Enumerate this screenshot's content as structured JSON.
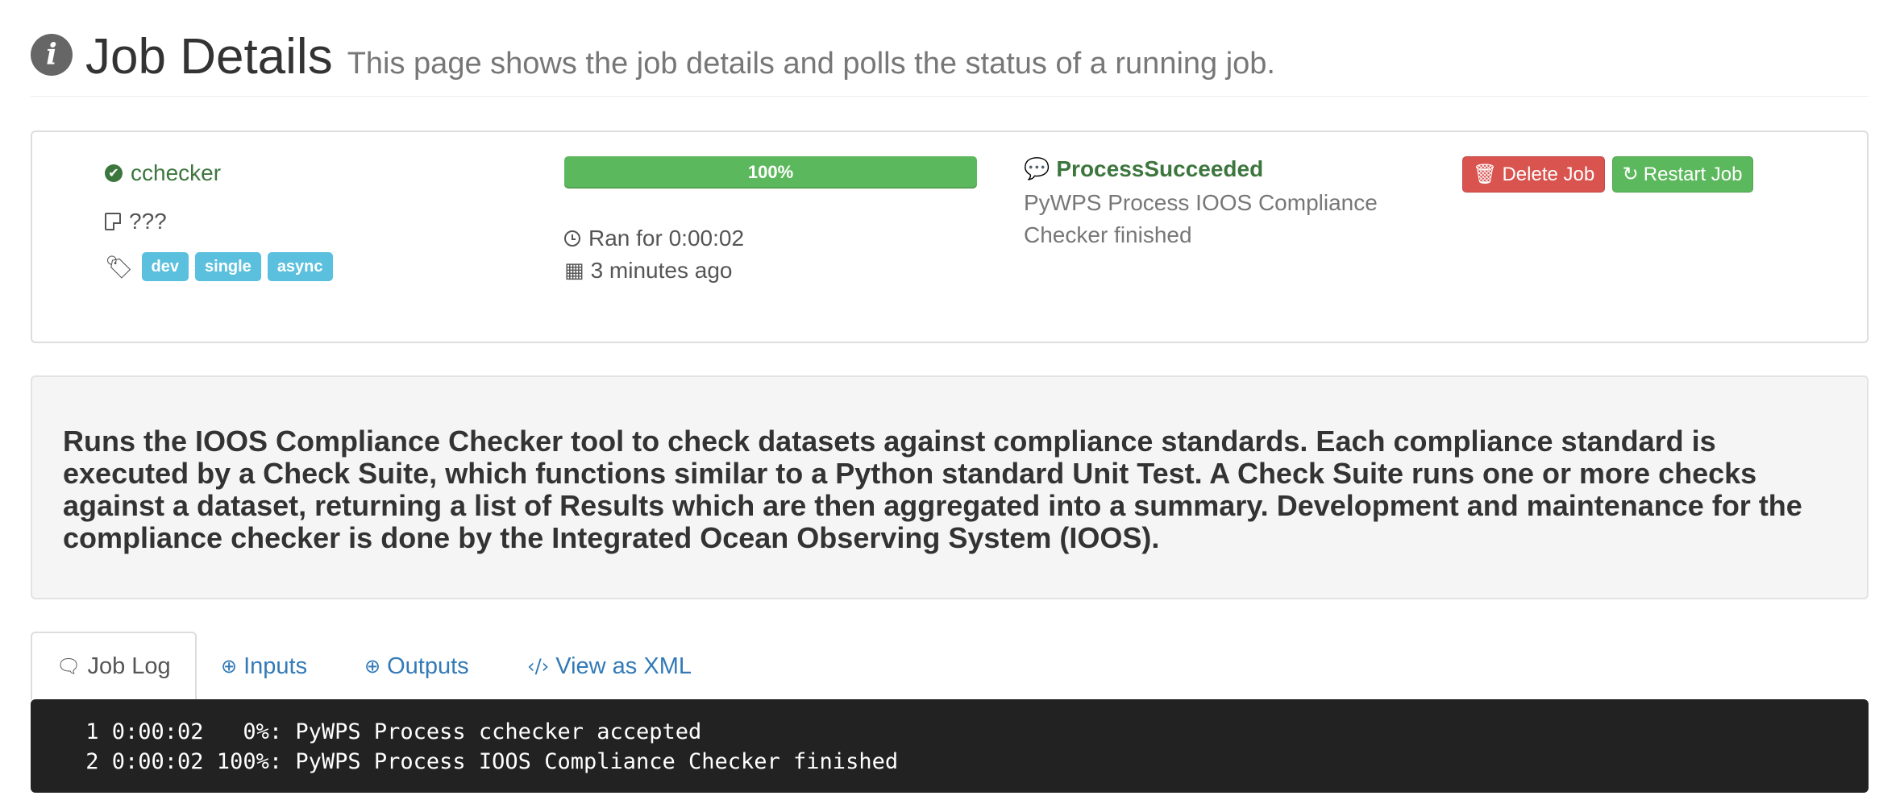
{
  "header": {
    "title": "Job Details",
    "subtitle": "This page shows the job details and polls the status of a running job."
  },
  "job": {
    "process_name": "cchecker",
    "title": "???",
    "tags": [
      "dev",
      "single",
      "async"
    ],
    "progress_label": "100%",
    "progress_fraction": 1.0,
    "duration": "Ran for 0:00:02",
    "finished": "3 minutes ago",
    "status": "ProcessSucceeded",
    "status_message": "PyWPS Process IOOS Compliance Checker finished",
    "buttons": {
      "delete": "Delete Job",
      "restart": "Restart Job"
    }
  },
  "description": "Runs the IOOS Compliance Checker tool to check datasets against compliance standards. Each compliance standard is executed by a Check Suite, which functions similar to a Python standard Unit Test. A Check Suite runs one or more checks against a dataset, returning a list of Results which are then aggregated into a summary. Development and maintenance for the compliance checker is done by the Integrated Ocean Observing System (IOOS).",
  "tabs": [
    {
      "label": "Job Log",
      "icon": "comments-icon",
      "active": true
    },
    {
      "label": "Inputs",
      "icon": "arrow-circle-down-icon",
      "active": false
    },
    {
      "label": "Outputs",
      "icon": "arrow-circle-up-icon",
      "active": false
    },
    {
      "label": "View as XML",
      "icon": "code-icon",
      "active": false
    }
  ],
  "log": [
    " 1 0:00:02   0%: PyWPS Process cchecker accepted",
    " 2 0:00:02 100%: PyWPS Process IOOS Compliance Checker finished"
  ],
  "colors": {
    "success": "#5cb85c",
    "success_text": "#3c763d",
    "danger": "#d9534f",
    "info": "#5bc0de",
    "link": "#337ab7"
  }
}
